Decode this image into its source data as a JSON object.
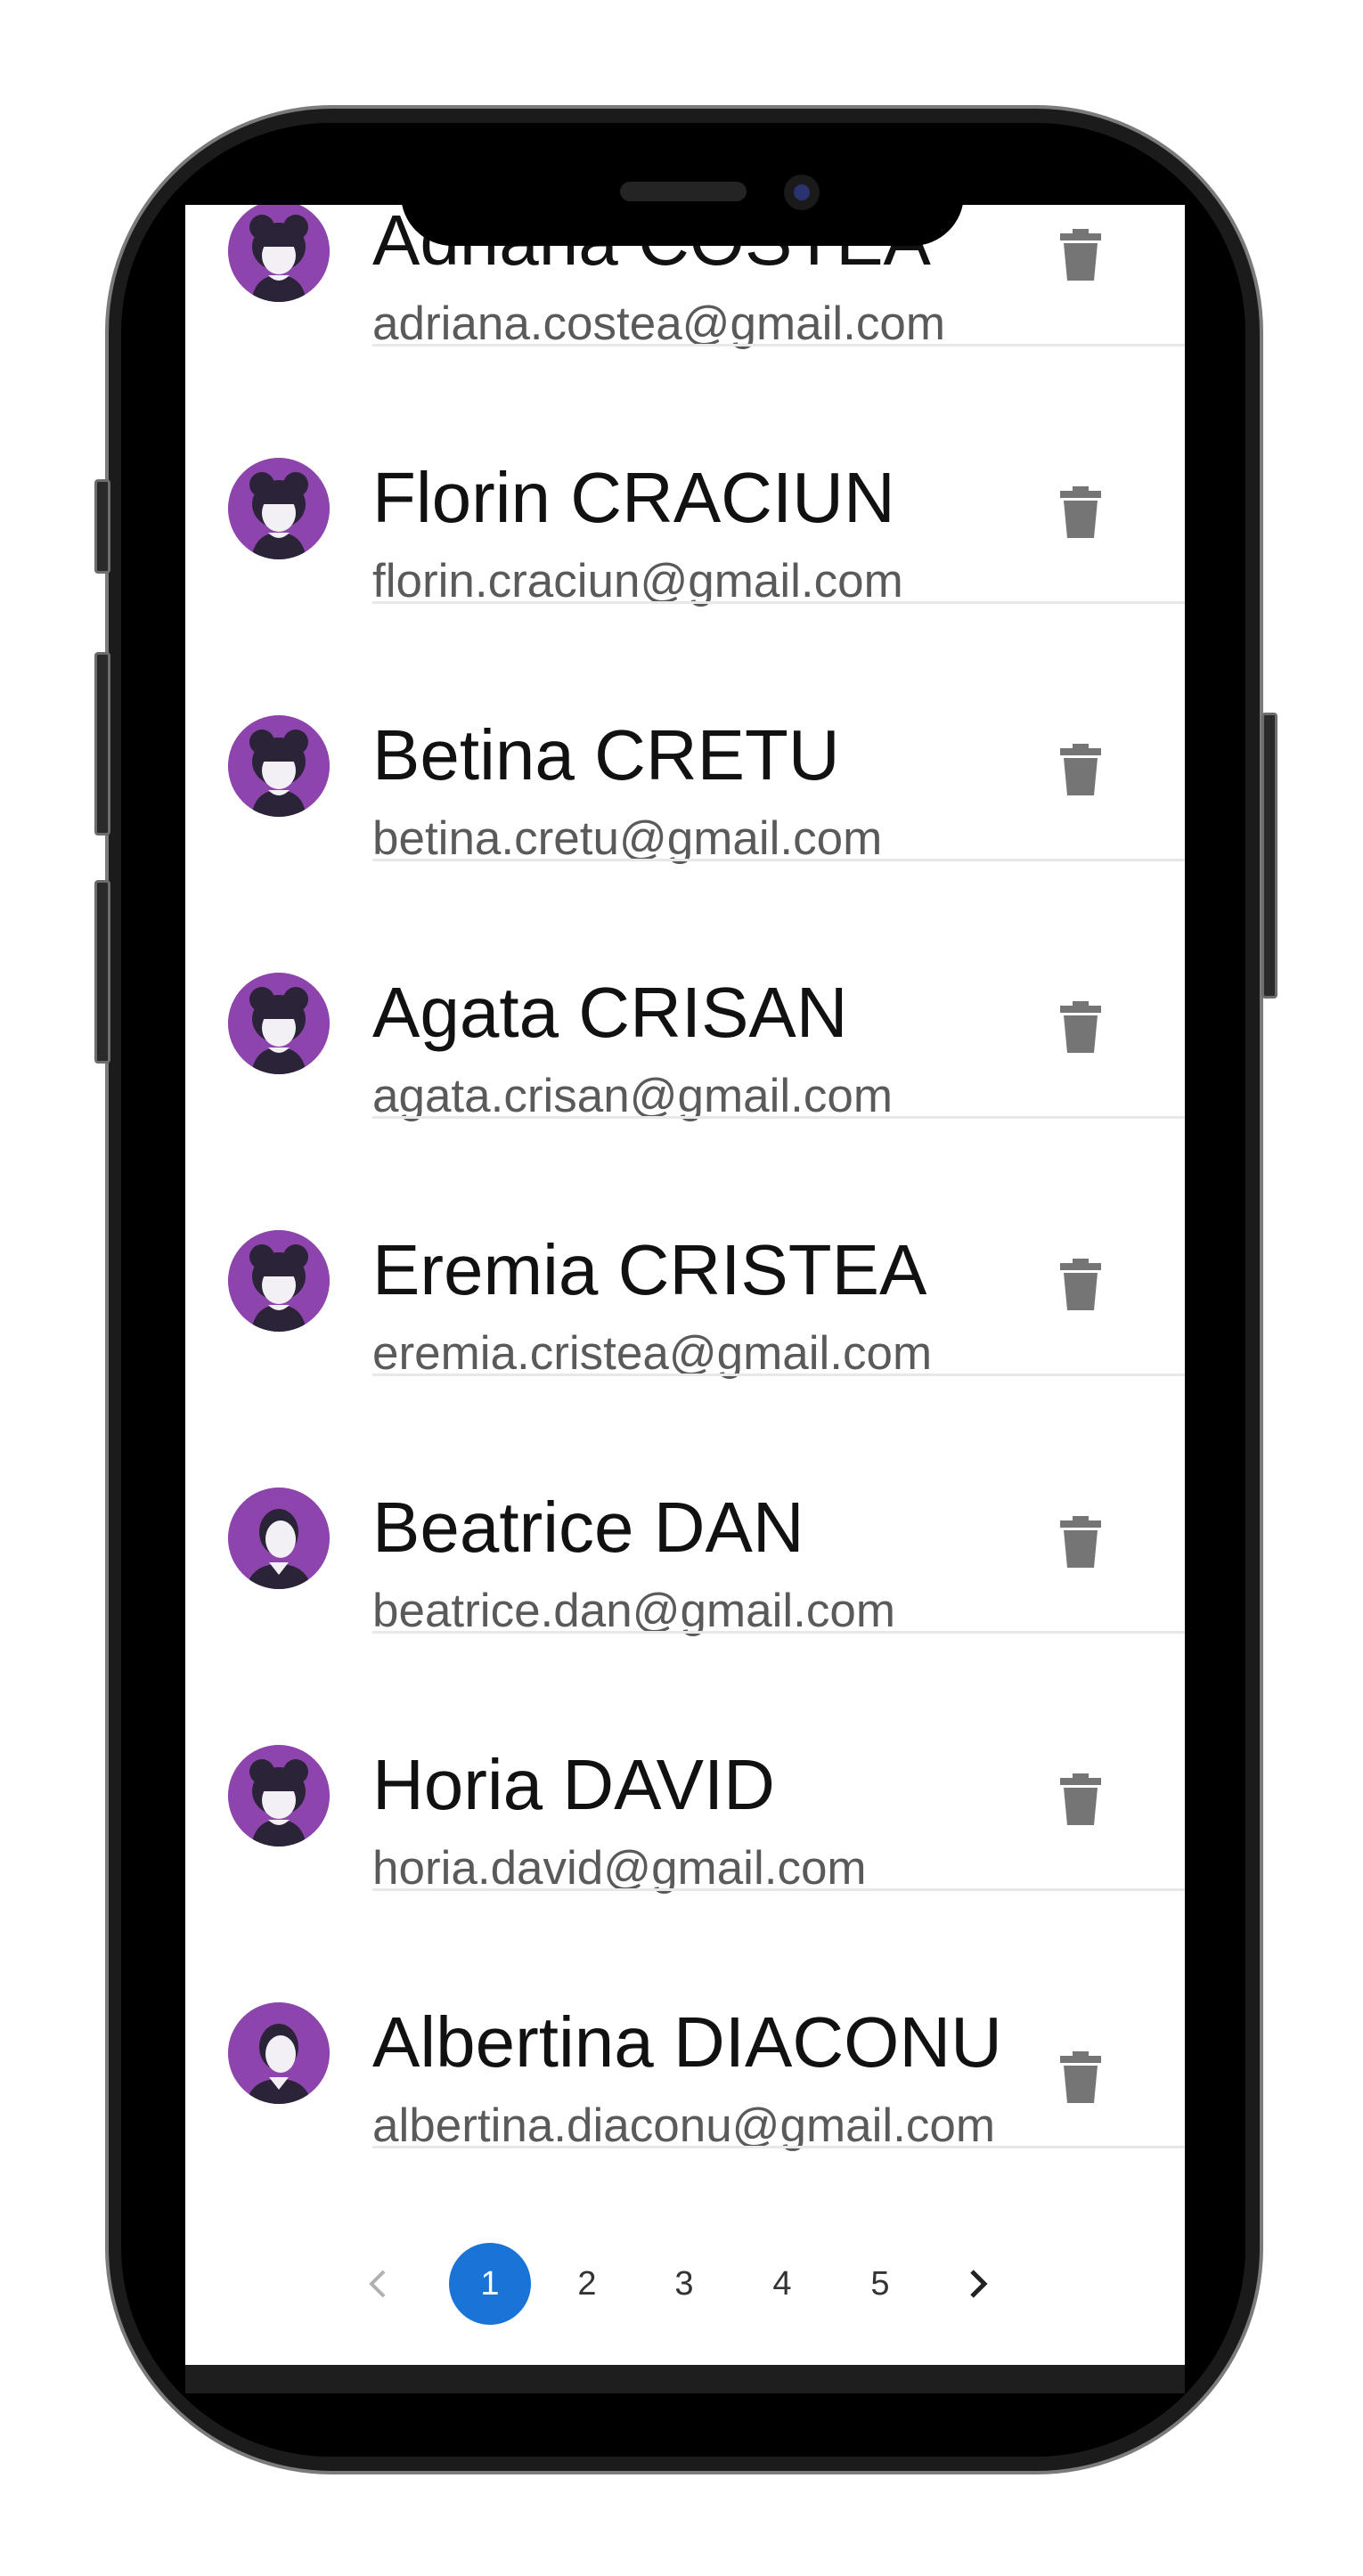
{
  "users": [
    {
      "name": "Adriana COSTEA",
      "email": "adriana.costea@gmail.com",
      "avatar": "female-avatar-icon"
    },
    {
      "name": "Florin CRACIUN",
      "email": "florin.craciun@gmail.com",
      "avatar": "female-avatar-icon"
    },
    {
      "name": "Betina CRETU",
      "email": "betina.cretu@gmail.com",
      "avatar": "female-avatar-icon"
    },
    {
      "name": "Agata CRISAN",
      "email": "agata.crisan@gmail.com",
      "avatar": "female-avatar-icon"
    },
    {
      "name": "Eremia CRISTEA",
      "email": "eremia.cristea@gmail.com",
      "avatar": "female-avatar-icon"
    },
    {
      "name": "Beatrice DAN",
      "email": "beatrice.dan@gmail.com",
      "avatar": "male-avatar-icon"
    },
    {
      "name": "Horia DAVID",
      "email": "horia.david@gmail.com",
      "avatar": "female-avatar-icon"
    },
    {
      "name": "Albertina DIACONU",
      "email": "albertina.diaconu@gmail.com",
      "avatar": "male-avatar-icon"
    }
  ],
  "pagination": {
    "prev_icon": "chevron-left-icon",
    "next_icon": "chevron-right-icon",
    "pages": [
      "1",
      "2",
      "3",
      "4",
      "5"
    ],
    "current": "1"
  },
  "colors": {
    "avatar_bg": "#8e44ad",
    "active_page": "#1a73d6",
    "delete_icon": "#757575"
  }
}
